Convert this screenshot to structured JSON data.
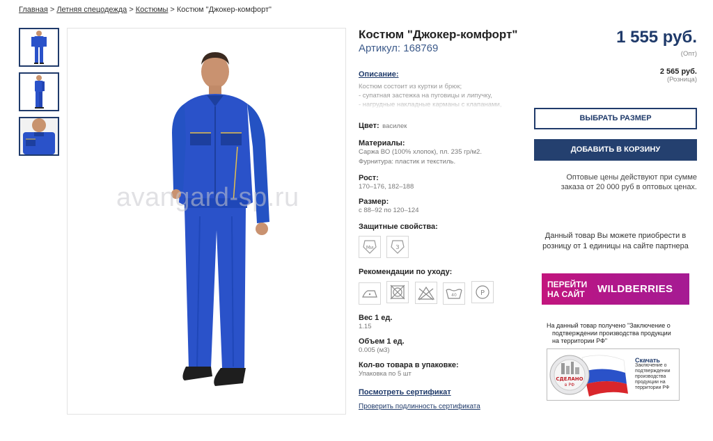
{
  "breadcrumb": {
    "items": [
      "Главная",
      "Летняя спецодежда",
      "Костюмы"
    ],
    "current": "Костюм \"Джокер-комфорт\"",
    "separator": ">"
  },
  "thumbnails": [
    "front-view",
    "side-view",
    "detail-view"
  ],
  "image": {
    "watermark": "avangard-sp.ru"
  },
  "product": {
    "title": "Костюм \"Джокер-комфорт\"",
    "sku_label": "Артикул:",
    "sku": "168769",
    "description_label": "Описание:",
    "description_lines": [
      "Костюм состоит из куртки и брюк;",
      "- супатная застежка на пуговицы и липучку,",
      "- нагрудные накладные карманы с клапанами,"
    ],
    "color_label": "Цвет:",
    "color_value": "василек",
    "materials_label": "Материалы:",
    "materials_lines": [
      "Саржа ВО (100% хлопок), пл. 235 гр/м2.",
      "Фурнитура: пластик и текстиль."
    ],
    "height_label": "Рост:",
    "height_value": "170–176, 182–188",
    "size_label": "Размер:",
    "size_value": "с 88–92 по 120–124",
    "protection_label": "Защитные свойства:",
    "protection_icons": [
      "Ми",
      "З"
    ],
    "care_label": "Рекомендации по уходу:",
    "care_icons": [
      "iron-icon",
      "no-tumble-dry-icon",
      "no-bleach-icon",
      "wash-40-icon",
      "dry-clean-p-icon"
    ],
    "weight_label": "Вес 1 ед.",
    "weight_value": "1.15",
    "volume_label": "Объем 1 ед.",
    "volume_value": "0.005 (м3)",
    "pack_label": "Кол-во товара в упаковке:",
    "pack_value": "Упаковка по 5 шт",
    "cert_link": "Посмотреть сертификат",
    "cert_check": "Проверить подлинность сертификата"
  },
  "buy": {
    "price": "1 555 руб.",
    "price_note": "(Опт)",
    "retail_price": "2 565 руб.",
    "retail_note": "(Розница)",
    "select_size": "ВЫБРАТЬ РАЗМЕР",
    "add_to_cart": "ДОБАВИТЬ В КОРЗИНУ",
    "wholesale_note_1": "Оптовые цены действуют при сумме",
    "wholesale_note_2": "заказа от 20 000 руб в оптовых ценах.",
    "partner_text_1": "Данный товар Вы можете приобрести в",
    "partner_text_2": "розницу от 1 единицы на сайте партнера",
    "wb_left_1": "ПЕРЕЙТИ",
    "wb_left_2": "НА САЙТ",
    "wb_brand": "WILDBERRIES",
    "conclusion_1": "На данный товар получено \"Заключение о",
    "conclusion_2": "подтверждении производства продукции",
    "conclusion_3": "на территории РФ\"",
    "made_download": "Скачать",
    "made_lines": [
      "Заключение о",
      "подтверждении",
      "производства",
      "продукции на",
      "территории РФ"
    ],
    "made_badge_1": "СДЕЛАНО",
    "made_badge_2": "в РФ"
  },
  "colors": {
    "accent": "#1f3a6a",
    "button": "#24406f",
    "suit": "#2a52c9",
    "wb": "#b1178a"
  }
}
